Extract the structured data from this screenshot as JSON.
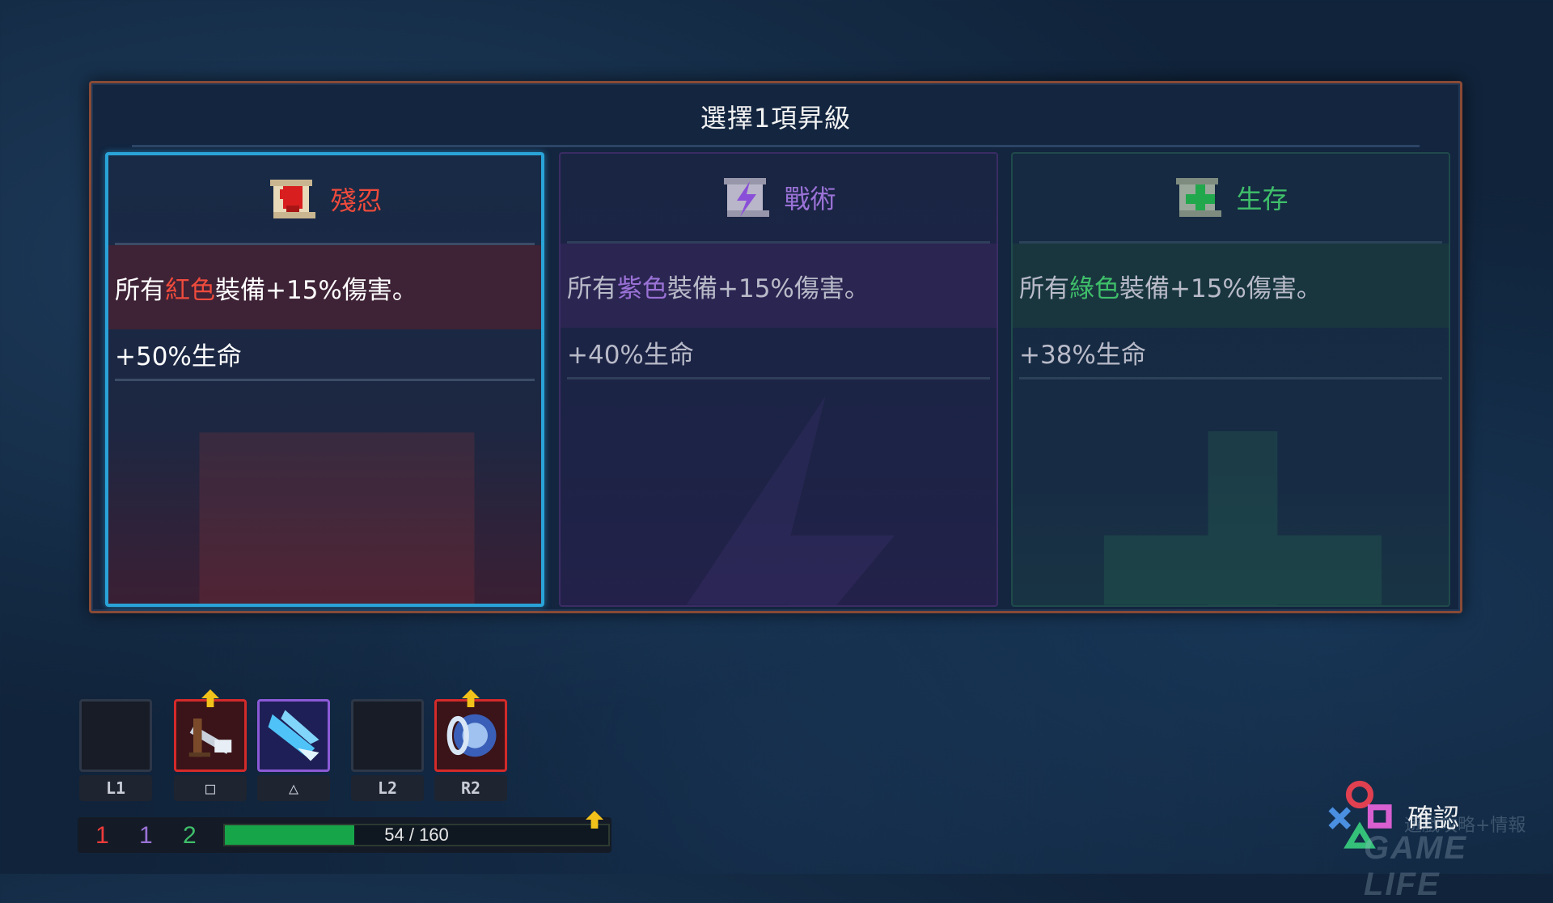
{
  "panel": {
    "title": "選擇1項昇級"
  },
  "cards": {
    "brutality": {
      "name": "殘忍",
      "effect_prefix": "所有",
      "effect_color_word": "紅色",
      "effect_suffix": "裝備+15%傷害。",
      "health_bonus": "+50%生命",
      "accent": "#ef4b3c",
      "selected": true,
      "icon": "red-fist-scroll-icon"
    },
    "tactics": {
      "name": "戰術",
      "effect_prefix": "所有",
      "effect_color_word": "紫色",
      "effect_suffix": "裝備+15%傷害。",
      "health_bonus": "+40%生命",
      "accent": "#9a72d6",
      "selected": false,
      "icon": "purple-lightning-scroll-icon"
    },
    "survival": {
      "name": "生存",
      "effect_prefix": "所有",
      "effect_color_word": "綠色",
      "effect_suffix": "裝備+15%傷害。",
      "health_bonus": "+38%生命",
      "accent": "#3fbf6a",
      "selected": false,
      "icon": "green-cross-scroll-icon"
    }
  },
  "hud": {
    "slots": [
      {
        "key": "L1",
        "type": "empty",
        "icon": "empty-slot"
      },
      {
        "key": "□",
        "type": "red",
        "icon": "crossbow-weapon-icon",
        "upgradable": true
      },
      {
        "key": "△",
        "type": "purple",
        "icon": "ice-shard-skill-icon",
        "upgradable": false
      },
      {
        "key": "L2",
        "type": "empty",
        "icon": "empty-slot"
      },
      {
        "key": "R2",
        "type": "red",
        "icon": "ring-orb-skill-icon",
        "upgradable": true
      }
    ],
    "scrolls": {
      "red": "1",
      "purple": "1",
      "green": "2"
    },
    "xp": {
      "current": "54",
      "separator": "/",
      "max": "160",
      "fraction": 0.3375
    }
  },
  "confirm": {
    "label": "確認",
    "icon": "gamepad-buttons-icon"
  },
  "watermark": {
    "line1": "遊戲攻略+情報",
    "line2": "GAME LIFE"
  },
  "colors": {
    "red": "#ef4b3c",
    "purple": "#9a72d6",
    "green": "#3fbf6a",
    "selection": "#2aa3d8",
    "panel_border": "#8a4a36"
  }
}
